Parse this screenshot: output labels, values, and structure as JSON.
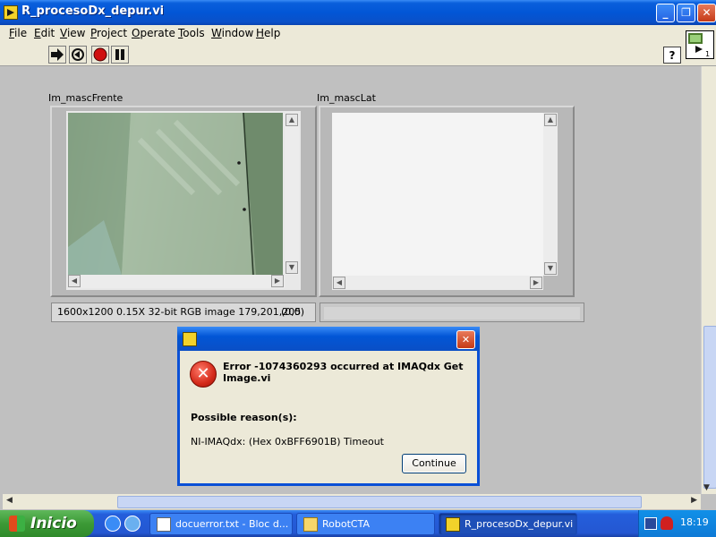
{
  "window": {
    "title": "R_procesoDx_depur.vi",
    "controls": {
      "minimize": "_",
      "restore": "❐",
      "close": "✕"
    }
  },
  "menu": [
    {
      "label_u": "F",
      "label_rest": "ile"
    },
    {
      "label_u": "E",
      "label_rest": "dit"
    },
    {
      "label_u": "V",
      "label_rest": "iew"
    },
    {
      "label_u": "P",
      "label_rest": "roject"
    },
    {
      "label_u": "O",
      "label_rest": "perate"
    },
    {
      "label_u": "T",
      "label_rest": "ools"
    },
    {
      "label_u": "W",
      "label_rest": "indow"
    },
    {
      "label_u": "H",
      "label_rest": "elp"
    }
  ],
  "toolbar": {
    "help_label": "?",
    "icons": [
      "run-arrow-icon",
      "run-continuously-icon",
      "abort-icon",
      "pause-icon"
    ]
  },
  "panel": {
    "image1": {
      "label": "Im_mascFrente",
      "status": "1600x1200 0.15X 32-bit RGB image 179,201,205",
      "coords": "(0,0)"
    },
    "image2": {
      "label": "Im_mascLat",
      "status": ""
    }
  },
  "dialog": {
    "error_message": "Error -1074360293 occurred at IMAQdx Get Image.vi",
    "reason_header": "Possible reason(s):",
    "reason_text": "NI-IMAQdx: (Hex 0xBFF6901B) Timeout",
    "continue_label": "Continue",
    "error_glyph": "✕"
  },
  "taskbar": {
    "start_label": "Inicio",
    "tasks": [
      {
        "label": "docuerror.txt - Bloc d...",
        "icon": "notepad-icon",
        "active": false
      },
      {
        "label": "RobotCTA",
        "icon": "folder-icon",
        "active": false
      },
      {
        "label": "R_procesoDx_depur.vi",
        "icon": "labview-icon",
        "active": true
      }
    ],
    "clock": "18:19"
  },
  "colors": {
    "titlebar": "#0256d6",
    "panel_bg": "#c0c0c0",
    "taskbar": "#245edb",
    "start_green": "#3c9a36",
    "error_red": "#d42a1a"
  }
}
